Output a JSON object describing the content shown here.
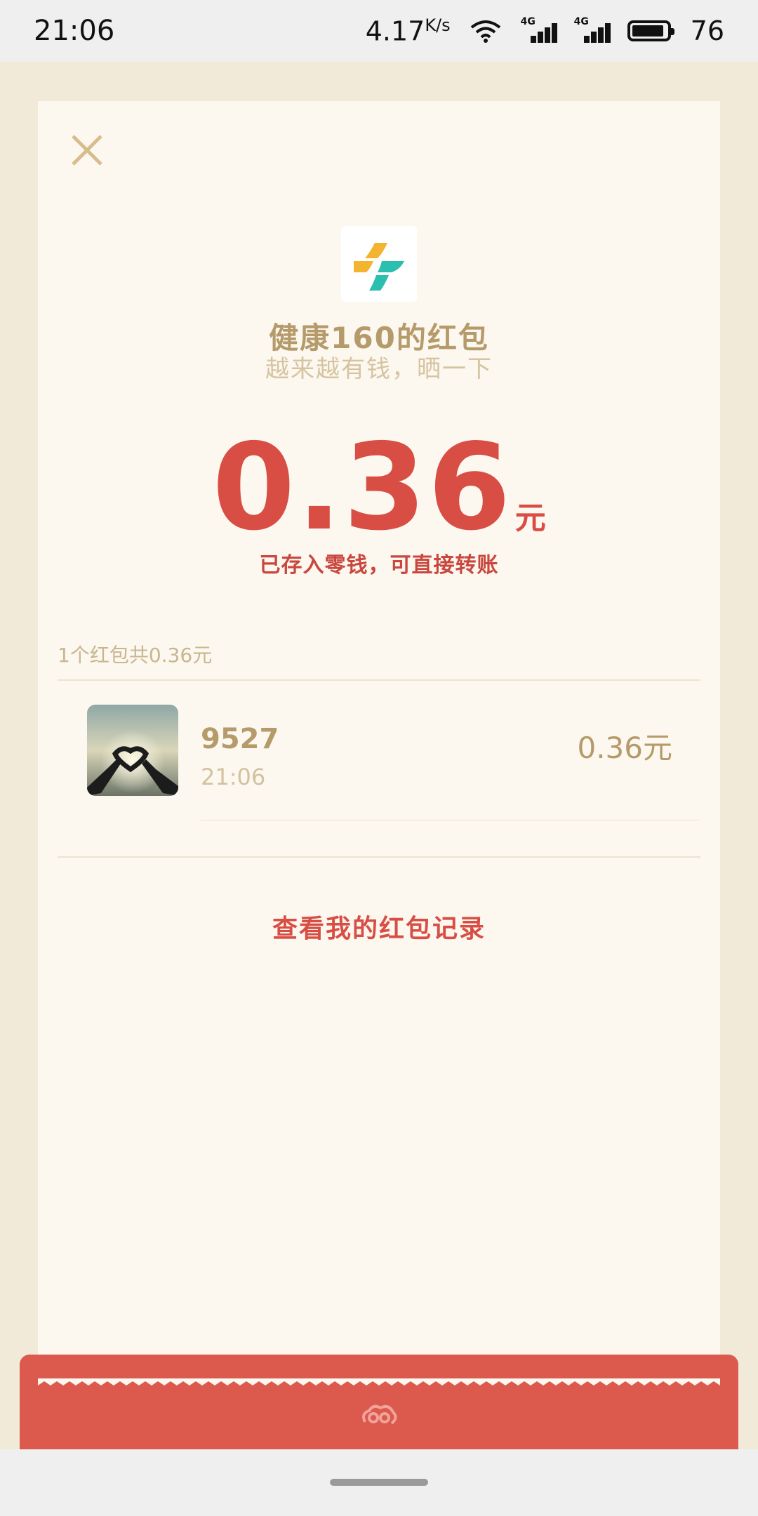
{
  "status_bar": {
    "time": "21:06",
    "net_speed": "4.17",
    "net_speed_unit": "K/s",
    "signal1_label": "4G",
    "signal2_label": "4G",
    "battery": "76"
  },
  "card": {
    "title": "健康160的红包",
    "subtitle": "越来越有钱，晒一下",
    "amount": "0.36",
    "amount_unit": "元",
    "note": "已存入零钱，可直接转账",
    "summary": "1个红包共0.36元",
    "records": [
      {
        "name": "9527",
        "time": "21:06",
        "amount": "0.36元"
      }
    ],
    "history_link": "查看我的红包记录"
  },
  "colors": {
    "accent_red": "#d84e44",
    "gold": "#b59a6a",
    "card_bg": "#fcf7ef",
    "page_bg": "#f2ead9",
    "envelope_red": "#db5a4d"
  }
}
